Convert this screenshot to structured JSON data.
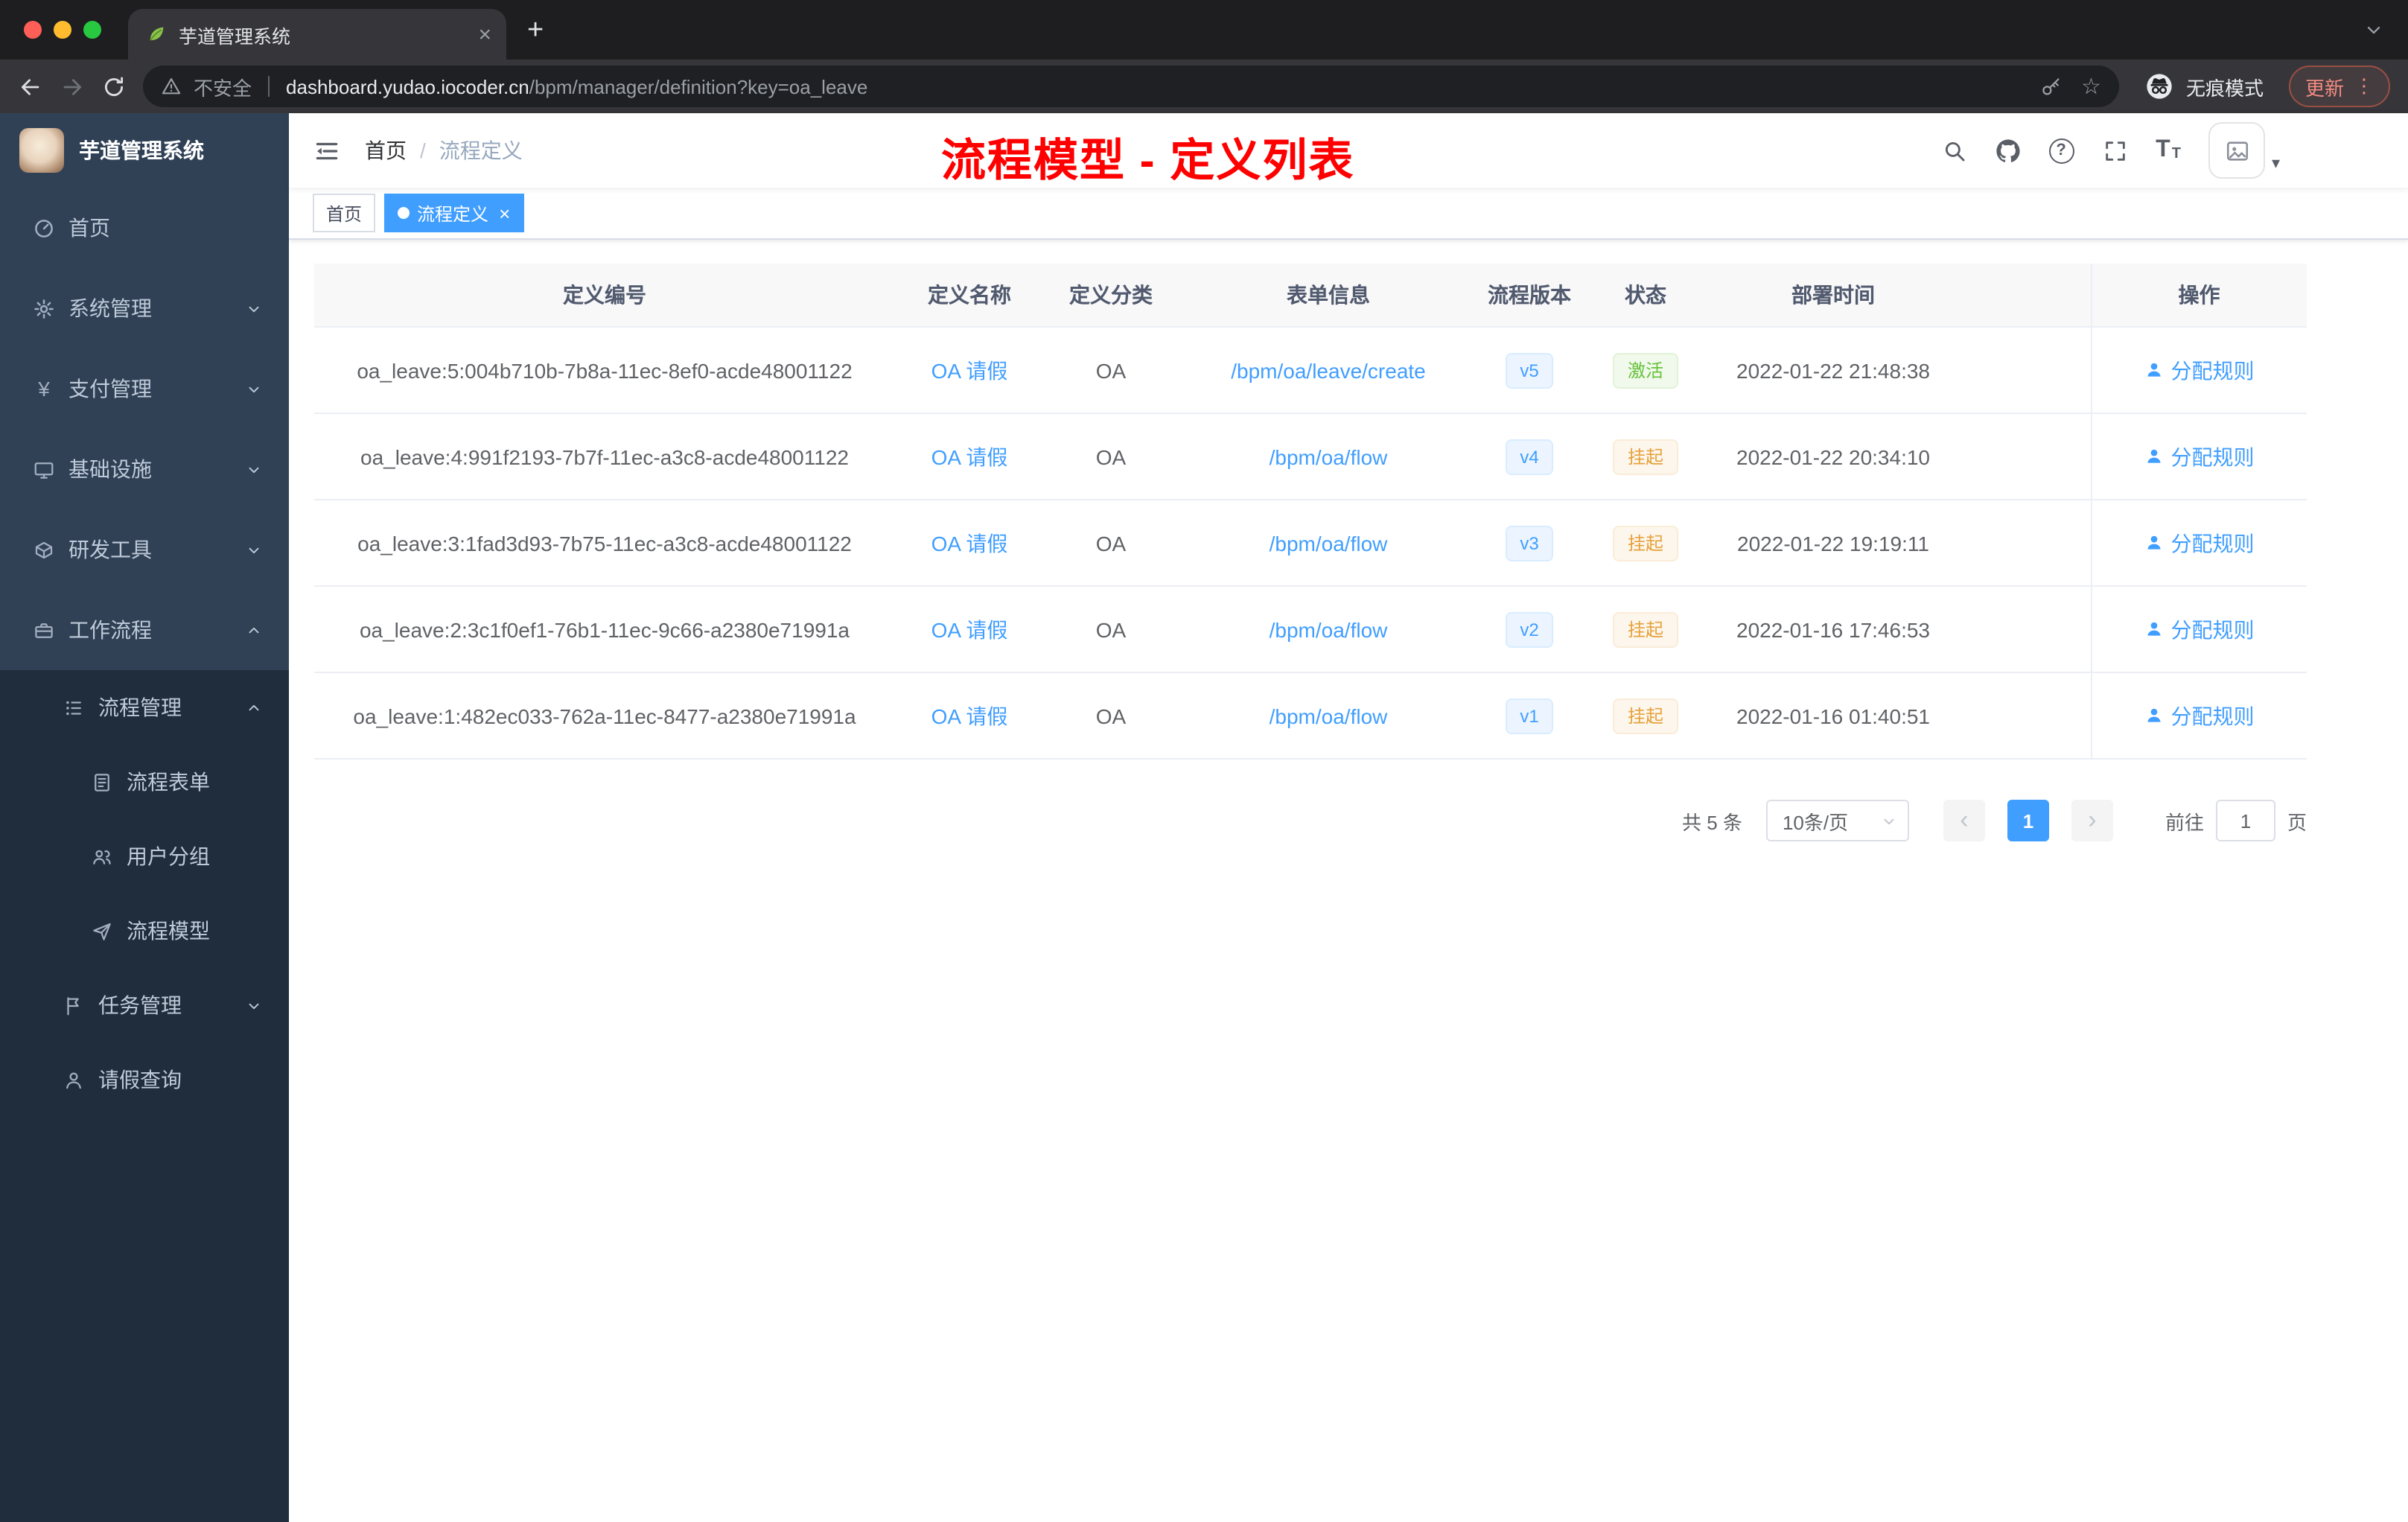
{
  "colors": {
    "accent": "#409eff",
    "success": "#67c23a",
    "warning": "#e6a23c",
    "annotation_red": "#ff0000",
    "sidebar_bg": "#304156",
    "sidebar_submenu_bg": "#1f2d3d"
  },
  "glyphs": {
    "close": "×",
    "plus": "+",
    "star": "☆",
    "dots": "⋮",
    "question": "?",
    "font_large": "T",
    "font_small": "T",
    "caret_down": "▾",
    "prev": "‹",
    "next": "›",
    "yen": "¥"
  },
  "browser": {
    "tab_title": "芋道管理系统",
    "security_label": "不安全",
    "url_host": "dashboard.yudao.iocoder.cn",
    "url_path": "/bpm/manager/definition?key=oa_leave",
    "incognito_label": "无痕模式",
    "update_label": "更新"
  },
  "sidebar": {
    "logo_title": "芋道管理系统",
    "items": [
      {
        "label": "首页"
      },
      {
        "label": "系统管理"
      },
      {
        "label": "支付管理"
      },
      {
        "label": "基础设施"
      },
      {
        "label": "研发工具"
      },
      {
        "label": "工作流程"
      },
      {
        "label": "流程管理"
      },
      {
        "label": "流程表单"
      },
      {
        "label": "用户分组"
      },
      {
        "label": "流程模型"
      },
      {
        "label": "任务管理"
      },
      {
        "label": "请假查询"
      }
    ]
  },
  "navbar": {
    "breadcrumb_home": "首页",
    "breadcrumb_sep": "/",
    "breadcrumb_current": "流程定义",
    "annotation": "流程模型 - 定义列表"
  },
  "tags": {
    "home": "首页",
    "active": "流程定义"
  },
  "table": {
    "headers": [
      "定义编号",
      "定义名称",
      "定义分类",
      "表单信息",
      "流程版本",
      "状态",
      "部署时间",
      "操作"
    ],
    "rows": [
      {
        "id": "oa_leave:5:004b710b-7b8a-11ec-8ef0-acde48001122",
        "name": "OA 请假",
        "category": "OA",
        "form": "/bpm/oa/leave/create",
        "version": "v5",
        "status": "激活",
        "status_type": "success",
        "time": "2022-01-22 21:48:38",
        "action": "分配规则"
      },
      {
        "id": "oa_leave:4:991f2193-7b7f-11ec-a3c8-acde48001122",
        "name": "OA 请假",
        "category": "OA",
        "form": "/bpm/oa/flow",
        "version": "v4",
        "status": "挂起",
        "status_type": "warning",
        "time": "2022-01-22 20:34:10",
        "action": "分配规则"
      },
      {
        "id": "oa_leave:3:1fad3d93-7b75-11ec-a3c8-acde48001122",
        "name": "OA 请假",
        "category": "OA",
        "form": "/bpm/oa/flow",
        "version": "v3",
        "status": "挂起",
        "status_type": "warning",
        "time": "2022-01-22 19:19:11",
        "action": "分配规则"
      },
      {
        "id": "oa_leave:2:3c1f0ef1-76b1-11ec-9c66-a2380e71991a",
        "name": "OA 请假",
        "category": "OA",
        "form": "/bpm/oa/flow",
        "version": "v2",
        "status": "挂起",
        "status_type": "warning",
        "time": "2022-01-16 17:46:53",
        "action": "分配规则"
      },
      {
        "id": "oa_leave:1:482ec033-762a-11ec-8477-a2380e71991a",
        "name": "OA 请假",
        "category": "OA",
        "form": "/bpm/oa/flow",
        "version": "v1",
        "status": "挂起",
        "status_type": "warning",
        "time": "2022-01-16 01:40:51",
        "action": "分配规则"
      }
    ]
  },
  "pagination": {
    "total": "共 5 条",
    "page_size": "10条/页",
    "page": "1",
    "goto": "前往",
    "goto_value": "1",
    "unit": "页"
  }
}
